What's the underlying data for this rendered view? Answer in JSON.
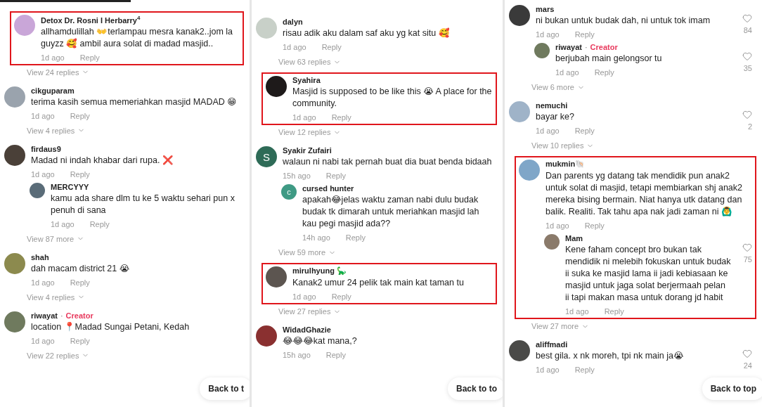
{
  "panels": [
    {
      "tab_indicator": true,
      "back_to_top": "Back to t",
      "comments": [
        {
          "author": "Detox Dr. Rosni I Herbarry$^{4}$",
          "avatar": {
            "kind": "photo",
            "color": "#c9a6d8"
          },
          "text": "allhamdulillah 👐terlampau mesra kanak2..jom la guyzz 🥰 ambil aura solat di madad masjid..",
          "time": "1d ago",
          "reply": "Reply",
          "highlighted": true,
          "view_more": "View 24 replies"
        },
        {
          "author": "cikguparam",
          "avatar": {
            "kind": "photo",
            "color": "#9aa3ad"
          },
          "text": "terima kasih semua memeriahkan masjid MADAD 😁",
          "time": "1d ago",
          "reply": "Reply",
          "highlighted": false,
          "view_more": "View 4 replies"
        },
        {
          "author": "firdaus9",
          "avatar": {
            "kind": "photo",
            "color": "#4a4038"
          },
          "text": "Madad ni indah khabar dari rupa. ❌",
          "time": "1d ago",
          "reply": "Reply",
          "highlighted": false,
          "replies": [
            {
              "author": "MERCYYY",
              "avatar": {
                "kind": "photo",
                "color": "#5a6c78"
              },
              "text": "kamu ada share dlm tu ke 5 waktu sehari pun x penuh di sana",
              "time": "1d ago",
              "reply": "Reply"
            }
          ],
          "view_more": "View 87 more"
        },
        {
          "author": "shah",
          "avatar": {
            "kind": "photo",
            "color": "#8c8a4e"
          },
          "text": "dah macam district 21 😭",
          "time": "1d ago",
          "reply": "Reply",
          "highlighted": false,
          "view_more": "View 4 replies"
        },
        {
          "author": "riwayat",
          "tag_separator": "·",
          "tag": "Creator",
          "avatar": {
            "kind": "photo",
            "color": "#6f7a5e"
          },
          "text": "location 📍Madad Sungai Petani, Kedah",
          "time": "1d ago",
          "reply": "Reply",
          "highlighted": false,
          "view_more": "View 22 replies"
        }
      ]
    },
    {
      "back_to_top": "Back to to",
      "comments": [
        {
          "author": "dalyn",
          "avatar": {
            "kind": "photo",
            "color": "#c8d0c8"
          },
          "text": "risau adik aku dalam saf aku yg kat situ 🥰",
          "time": "1d ago",
          "reply": "Reply",
          "highlighted": false,
          "view_more": "View 63 replies"
        },
        {
          "author": "Syahira",
          "avatar": {
            "kind": "photo",
            "color": "#1e1a1a"
          },
          "text": "Masjid is supposed to be like this 😭 A place for the community.",
          "time": "1d ago",
          "reply": "Reply",
          "highlighted": true,
          "view_more": "View 12 replies"
        },
        {
          "author": "Syakir Zufairi",
          "avatar": {
            "kind": "letter",
            "letter": "S",
            "color": "#2e6b57"
          },
          "text": "walaun ni nabi tak pernah buat dia buat benda bidaah",
          "time": "15h ago",
          "reply": "Reply",
          "highlighted": false,
          "replies": [
            {
              "author": "cursed hunter",
              "avatar": {
                "kind": "letter",
                "letter": "c",
                "color": "#3f9a84"
              },
              "text": "apakah😂jelas waktu zaman nabi dulu budak budak tk dimarah untuk meriahkan masjid lah kau pegi masjid ada??",
              "time": "14h ago",
              "reply": "Reply"
            }
          ],
          "view_more": "View 59 more"
        },
        {
          "author": "mirulhyung 🦕",
          "avatar": {
            "kind": "photo",
            "color": "#5c5550"
          },
          "text": "Kanak2 umur 24 pelik tak main kat taman tu",
          "time": "1d ago",
          "reply": "Reply",
          "highlighted": true,
          "view_more": "View 27 replies"
        },
        {
          "author": "WidadGhazie",
          "avatar": {
            "kind": "photo",
            "color": "#8a3030"
          },
          "text": "😂😂😂kat mana,?",
          "time": "15h ago",
          "reply": "Reply",
          "highlighted": false
        }
      ]
    },
    {
      "back_to_top": "Back to top",
      "comments": [
        {
          "author": "mars",
          "avatar": {
            "kind": "photo",
            "color": "#3a3a3a"
          },
          "text": "ni bukan untuk budak dah, ni untuk tok imam",
          "time": "1d ago",
          "reply": "Reply",
          "likes": "84",
          "highlighted": false,
          "replies": [
            {
              "author": "riwayat",
              "tag_separator": "·",
              "tag": "Creator",
              "avatar": {
                "kind": "photo",
                "color": "#6f7a5e"
              },
              "text": "berjubah main gelongsor tu",
              "time": "1d ago",
              "reply": "Reply",
              "likes": "35"
            }
          ],
          "view_more": "View 6 more"
        },
        {
          "author": "nemuchi",
          "avatar": {
            "kind": "photo",
            "color": "#9fb3c8"
          },
          "text": "bayar ke?",
          "time": "1d ago",
          "reply": "Reply",
          "likes": "2",
          "highlighted": false,
          "view_more": "View 10 replies"
        },
        {
          "author": "mukmin🐚",
          "avatar": {
            "kind": "photo",
            "color": "#7fa6c8"
          },
          "text": "Dan parents yg datang tak mendidik pun anak2 untuk solat di masjid, tetapi membiarkan shj anak2 mereka bising bermain. Niat hanya utk datang dan balik. Realiti. Tak tahu apa nak jadi zaman ni 🙆‍♂️",
          "time": "1d ago",
          "reply": "Reply",
          "highlighted": true,
          "replies": [
            {
              "author": "Mam",
              "avatar": {
                "kind": "photo",
                "color": "#8a7a6a"
              },
              "text": "Kene faham concept bro bukan tak mendidik ni melebih fokuskan untuk budak ii suka ke masjid lama ii jadi kebiasaan ke masjid untuk jaga solat berjermaah pelan ii tapi makan masa untuk dorang jd habit",
              "time": "1d ago",
              "reply": "Reply",
              "likes": "75"
            }
          ],
          "view_more": "View 27 more"
        },
        {
          "author": "aliffmadi",
          "avatar": {
            "kind": "photo",
            "color": "#4a4a48"
          },
          "text": "best gila. x nk moreh, tpi nk main ja😭",
          "time": "1d ago",
          "reply": "Reply",
          "likes": "24",
          "highlighted": false
        }
      ]
    }
  ]
}
